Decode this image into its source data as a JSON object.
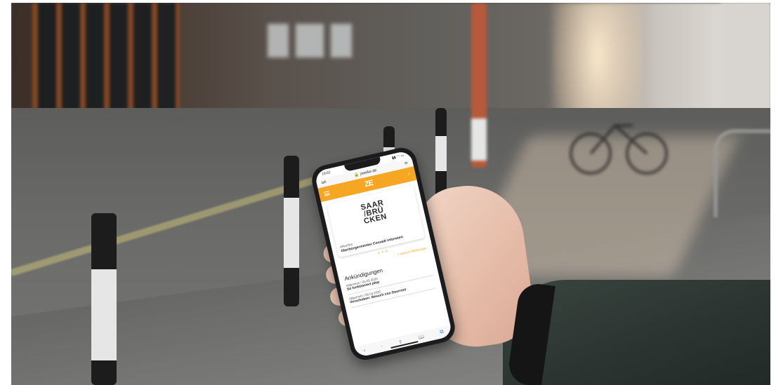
{
  "phone": {
    "status_time": "10:02",
    "url_aa": "aA",
    "url_text": "🔒 zweike.de",
    "reload_icon": "⟳",
    "app_logo": "ZE",
    "search_icon": "⌕",
    "city_logo_lines": [
      "SAAR",
      "BRÜ",
      "CKEN"
    ],
    "news_category": "Aktuelles",
    "news_title": "Oberbürgermeister Conradt informiert",
    "carousel_dots": "• • •",
    "more_news_link": "> Weitere Meldungen",
    "section_title": "Ankündigungen",
    "announcements": [
      {
        "meta": "Allgemein / 26.05.2020",
        "title": "So funktioniert plop"
      },
      {
        "meta": "Allgemein / 06.04.2020",
        "title": "Verschoben: Besuch von Deurrent"
      }
    ],
    "toolbar_icons": [
      "‹",
      "›",
      "⇪",
      "📖",
      "⧉"
    ]
  },
  "colors": {
    "accent_orange": "#f6a623",
    "logo_blue": "#2a5d8a"
  }
}
